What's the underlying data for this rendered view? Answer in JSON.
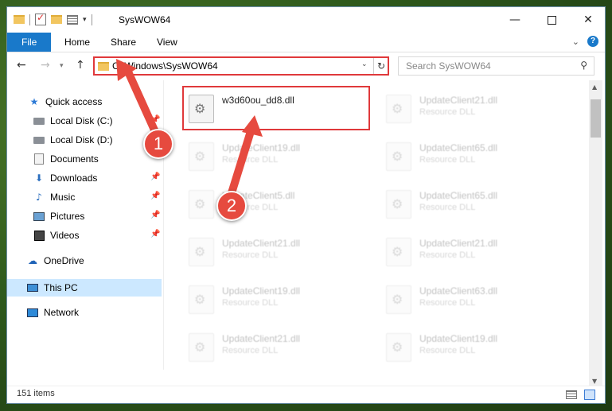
{
  "window": {
    "title": "SysWOW64"
  },
  "ribbon": {
    "tabs": [
      "File",
      "Home",
      "Share",
      "View"
    ]
  },
  "address": {
    "path": "C:\\Windows\\SysWOW64"
  },
  "search": {
    "placeholder": "Search SysWOW64"
  },
  "sidebar": {
    "items": [
      {
        "label": "Quick access",
        "icon": "star-icon"
      },
      {
        "label": "Local Disk (C:)",
        "icon": "drive-icon"
      },
      {
        "label": "Local Disk (D:)",
        "icon": "drive-icon"
      },
      {
        "label": "Documents",
        "icon": "documents-icon"
      },
      {
        "label": "Downloads",
        "icon": "downloads-icon"
      },
      {
        "label": "Music",
        "icon": "music-icon"
      },
      {
        "label": "Pictures",
        "icon": "pictures-icon"
      },
      {
        "label": "Videos",
        "icon": "videos-icon"
      },
      {
        "label": "OneDrive",
        "icon": "onedrive-icon"
      },
      {
        "label": "This PC",
        "icon": "computer-icon"
      },
      {
        "label": "Network",
        "icon": "network-icon"
      }
    ]
  },
  "files": {
    "highlighted": {
      "name": "w3d60ou_dd8.dll",
      "type": ""
    },
    "left_column": [
      {
        "name": "UpdateClient19.dll",
        "type": "Resource DLL"
      },
      {
        "name": "UpdateClient5.dll",
        "type": "Resource DLL"
      },
      {
        "name": "UpdateClient21.dll",
        "type": "Resource DLL"
      },
      {
        "name": "UpdateClient19.dll",
        "type": "Resource DLL"
      },
      {
        "name": "UpdateClient21.dll",
        "type": "Resource DLL"
      }
    ],
    "right_column": [
      {
        "name": "UpdateClient21.dll",
        "type": "Resource DLL"
      },
      {
        "name": "UpdateClient65.dll",
        "type": "Resource DLL"
      },
      {
        "name": "UpdateClient65.dll",
        "type": "Resource DLL"
      },
      {
        "name": "UpdateClient21.dll",
        "type": "Resource DLL"
      },
      {
        "name": "UpdateClient63.dll",
        "type": "Resource DLL"
      },
      {
        "name": "UpdateClient19.dll",
        "type": "Resource DLL"
      }
    ]
  },
  "status": {
    "item_count": "151 items"
  },
  "annotations": {
    "step1": "1",
    "step2": "2",
    "color": "#e0393b"
  }
}
